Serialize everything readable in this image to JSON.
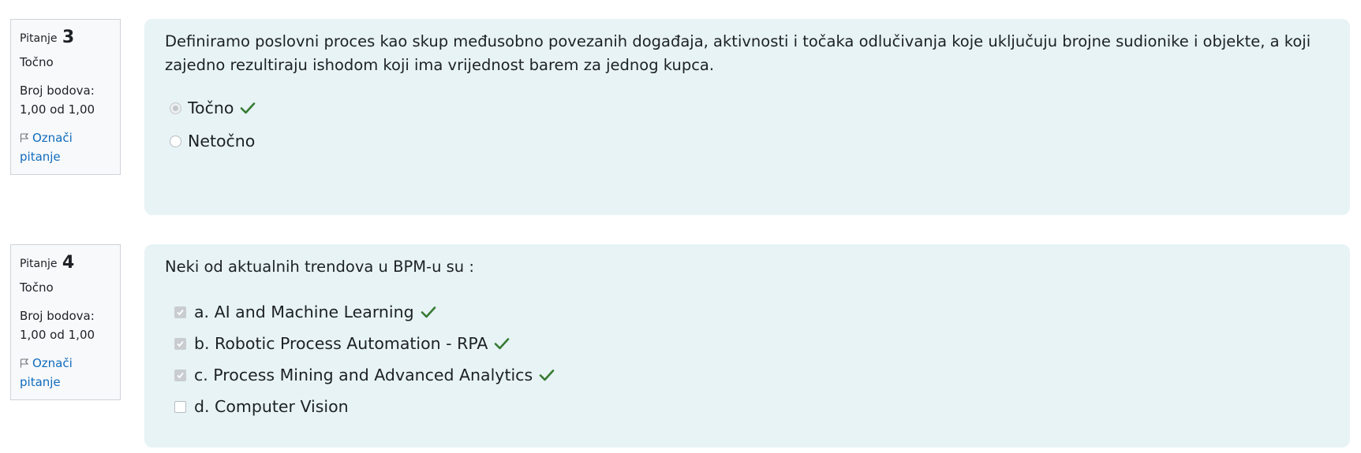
{
  "colors": {
    "accent_link": "#0f6cbf",
    "correct_green": "#357a32",
    "content_bg": "#e7f3f5",
    "info_bg": "#f8f9fa"
  },
  "questions": [
    {
      "label": "Pitanje",
      "number": "3",
      "state": "Točno",
      "grade_label": "Broj bodova:",
      "grade_value": "1,00 od 1,00",
      "flag_label_1": "Označi",
      "flag_label_2": "pitanje",
      "flag_icon": "flag-icon",
      "text": "Definiramo poslovni proces kao skup međusobno povezanih događaja, aktivnosti i točaka odlučivanja koje uključuju brojne sudionike i objekte, a koji zajedno rezultiraju ishodom koji ima vrijednost barem za jednog kupca.",
      "answer_type": "radio",
      "answers": [
        {
          "label": "Točno",
          "selected": true,
          "correct_mark": true
        },
        {
          "label": "Netočno",
          "selected": false,
          "correct_mark": false
        }
      ]
    },
    {
      "label": "Pitanje",
      "number": "4",
      "state": "Točno",
      "grade_label": "Broj bodova:",
      "grade_value": "1,00 od 1,00",
      "flag_label_1": "Označi",
      "flag_label_2": "pitanje",
      "flag_icon": "flag-icon",
      "text": "Neki od aktualnih trendova u BPM-u su :",
      "answer_type": "checkbox",
      "answers": [
        {
          "label": "a. AI and Machine Learning",
          "selected": true,
          "correct_mark": true
        },
        {
          "label": "b. Robotic Process Automation - RPA",
          "selected": true,
          "correct_mark": true
        },
        {
          "label": "c. Process Mining and Advanced Analytics",
          "selected": true,
          "correct_mark": true
        },
        {
          "label": "d. Computer Vision",
          "selected": false,
          "correct_mark": false
        }
      ]
    }
  ]
}
